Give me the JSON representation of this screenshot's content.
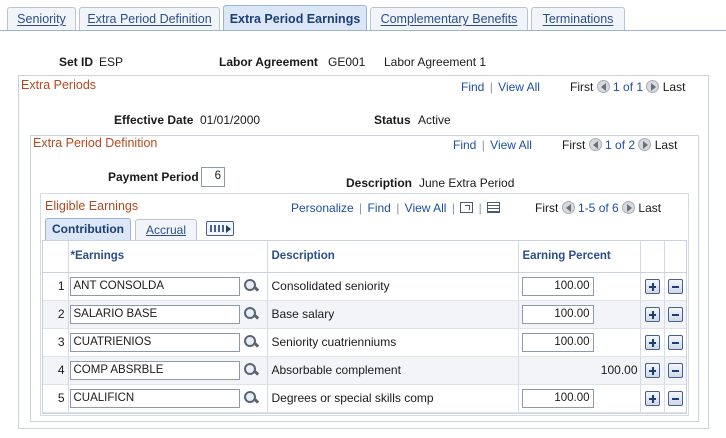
{
  "tabs": [
    "Seniority",
    "Extra Period Definition",
    "Extra Period Earnings",
    "Complementary Benefits",
    "Terminations"
  ],
  "header": {
    "setid_label": "Set ID",
    "setid_value": "ESP",
    "agreement_label": "Labor Agreement",
    "agreement_code": "GE001",
    "agreement_desc": "Labor Agreement 1"
  },
  "extra_periods": {
    "title": "Extra Periods",
    "find": "Find",
    "view_all": "View All",
    "first": "First",
    "count": "1 of 1",
    "last": "Last",
    "effdt_label": "Effective Date",
    "effdt_value": "01/01/2000",
    "status_label": "Status",
    "status_value": "Active"
  },
  "definition": {
    "title": "Extra Period Definition",
    "find": "Find",
    "view_all": "View All",
    "first": "First",
    "count": "1 of 2",
    "last": "Last",
    "payment_label": "Payment Period",
    "payment_value": "6",
    "desc_label": "Description",
    "desc_value": "June Extra Period"
  },
  "eligible": {
    "title": "Eligible Earnings",
    "personalize": "Personalize",
    "find": "Find",
    "view_all": "View All",
    "first": "First",
    "count": "1-5 of 6",
    "last": "Last",
    "subtabs": [
      "Contribution",
      "Accrual"
    ],
    "columns": [
      "*Earnings",
      "Description",
      "Earning Percent"
    ],
    "rows": [
      {
        "num": "1",
        "code": "ANT CONSOLDA",
        "desc": "Consolidated seniority",
        "pct": "100.00",
        "editable": true
      },
      {
        "num": "2",
        "code": "SALARIO BASE",
        "desc": "Base salary",
        "pct": "100.00",
        "editable": true
      },
      {
        "num": "3",
        "code": "CUATRIENIOS",
        "desc": "Seniority cuatrienniums",
        "pct": "100.00",
        "editable": true
      },
      {
        "num": "4",
        "code": "COMP ABSRBLE",
        "desc": "Absorbable complement",
        "pct": "100.00",
        "editable": false
      },
      {
        "num": "5",
        "code": "CUALIFICN",
        "desc": "Degrees or special skills comp",
        "pct": "100.00",
        "editable": true
      }
    ]
  }
}
